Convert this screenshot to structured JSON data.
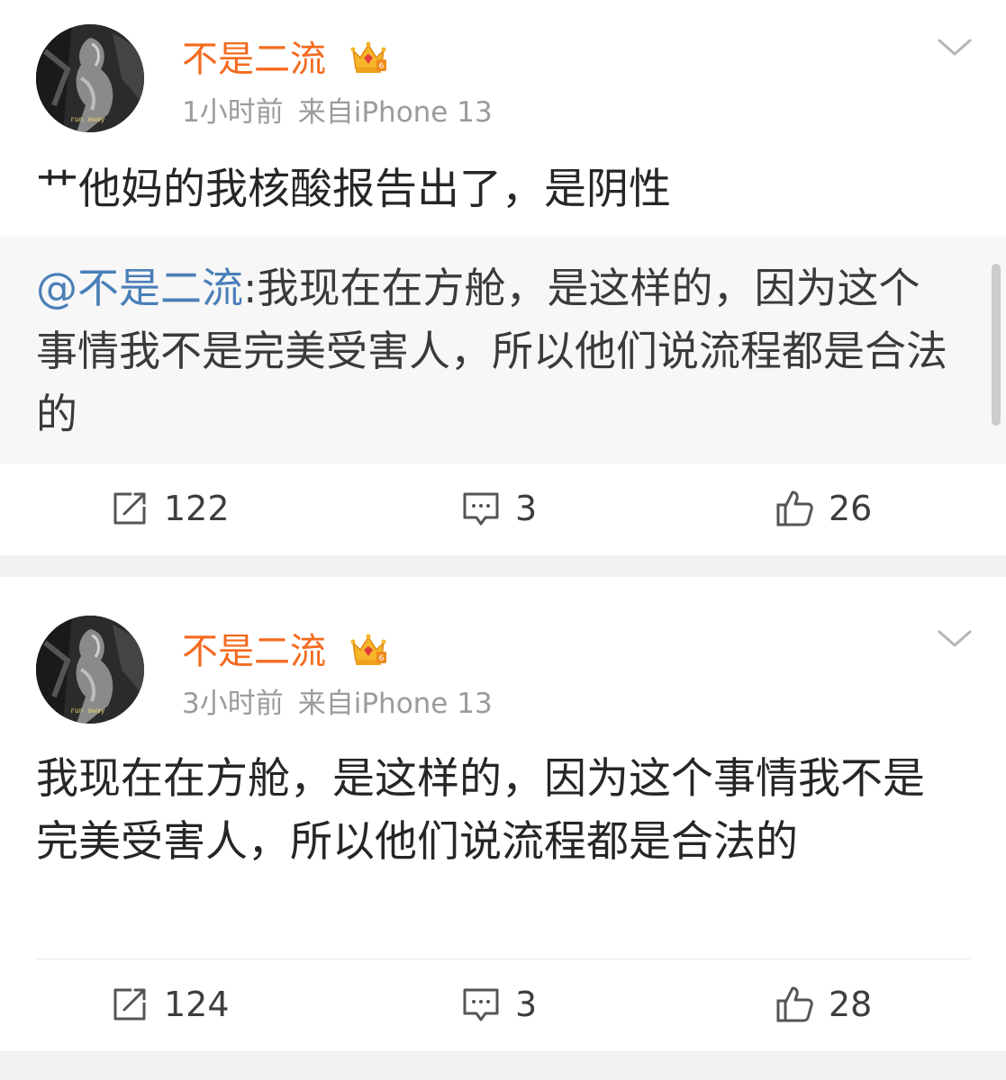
{
  "posts": [
    {
      "username": "不是二流",
      "avatar_caption": "run away",
      "time": "1小时前",
      "source": "来自iPhone 13",
      "text": "艹他妈的我核酸报告出了，是阴性",
      "repost": {
        "mention": "@不是二流",
        "separator": ":",
        "text": "我现在在方舱，是这样的，因为这个事情我不是完美受害人，所以他们说流程都是合法的"
      },
      "reposts": "122",
      "comments": "3",
      "likes": "26"
    },
    {
      "username": "不是二流",
      "avatar_caption": "run away",
      "time": "3小时前",
      "source": "来自iPhone 13",
      "text": "我现在在方舱，是这样的，因为这个事情我不是完美受害人，所以他们说流程都是合法的",
      "reposts": "124",
      "comments": "3",
      "likes": "28"
    }
  ],
  "colors": {
    "username": "#f46a1e",
    "mention": "#4a7fb8",
    "meta": "#9b9b9b",
    "text": "#262626"
  },
  "icons": [
    "avatar-photo",
    "vip-crown-icon",
    "chevron-down-icon",
    "repost-icon",
    "comment-icon",
    "like-icon"
  ]
}
